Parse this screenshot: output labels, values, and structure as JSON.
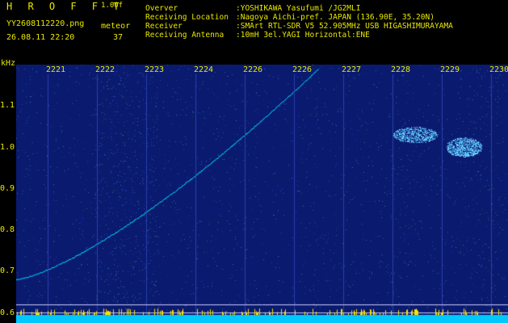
{
  "header": {
    "logo": "H R O F F T",
    "version": "1.00f",
    "filename": "YY2608112220.png",
    "meteor_label": "meteor",
    "timestamp": "26.08.11 22:20",
    "meteor_count": "37"
  },
  "info": {
    "rows": [
      {
        "key": "Overver",
        "value": ":YOSHIKAWA Yasufumi /JG2MLI"
      },
      {
        "key": "Receiving Location",
        "value": ":Nagoya Aichi-pref. JAPAN (136.90E, 35.20N)"
      },
      {
        "key": "Receiver",
        "value": ":SMArt RTL-SDR V5 52.905MHz USB HIGASHIMURAYAMA"
      },
      {
        "key": "Receiving Antenna",
        "value": ":10mH 3el.YAGI Horizontal:ENE"
      }
    ]
  },
  "colors": {
    "text": "#e8e800",
    "background": "#000000",
    "spectrum_bg": "#0a1a6e",
    "signal": "#00e0ff",
    "bottom_band": "#00c8ff"
  },
  "chart_data": {
    "type": "heatmap",
    "ylabel": "kHz",
    "ylim": [
      0.58,
      1.2
    ],
    "yticks": [
      "1.1",
      "1.0",
      "0.9",
      "0.8",
      "0.7",
      "0.6"
    ],
    "ytick_values": [
      1.1,
      1.0,
      0.9,
      0.8,
      0.7,
      0.6
    ],
    "x_tick_labels": [
      "2221",
      "2222",
      "2223",
      "2224",
      "2226",
      "2226",
      "2227",
      "2228",
      "2229",
      "2230"
    ],
    "reference_lines_khz": [
      0.6,
      0.62
    ],
    "meteor_trace": {
      "start_khz": 0.68,
      "end_khz": 1.19
    }
  }
}
